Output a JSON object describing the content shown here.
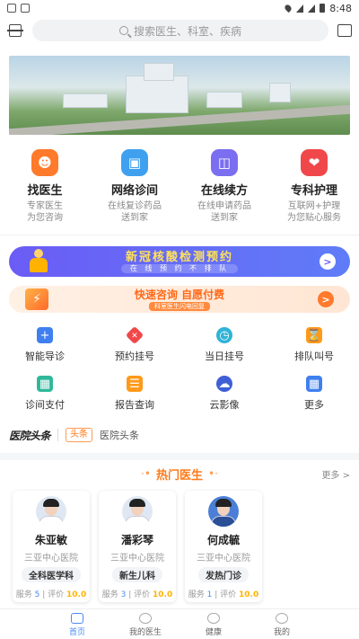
{
  "status_bar": {
    "time": "8:48"
  },
  "search": {
    "placeholder": "搜索医生、科室、疾病"
  },
  "main_services": [
    {
      "title": "找医生",
      "desc": "专家医生\n为您咨询",
      "color": "#ff7a2b",
      "icon": "doctor-icon"
    },
    {
      "title": "网络诊间",
      "desc": "在线复诊药品\n送到家",
      "color": "#3fa0f0",
      "icon": "monitor-icon"
    },
    {
      "title": "在线续方",
      "desc": "在线申请药品\n送到家",
      "color": "#7b6ef0",
      "icon": "capsule-icon"
    },
    {
      "title": "专科护理",
      "desc": "互联网+护理\n为您贴心服务",
      "color": "#f0484a",
      "icon": "heart-icon"
    }
  ],
  "promo1": {
    "title": "新冠核酸检测预约",
    "subtitle": "在 线 预 约  不 排 队"
  },
  "promo2": {
    "title": "快速咨询 自愿付费",
    "subtitle": "科室医生闪电回复"
  },
  "quick_grid": [
    {
      "label": "智能导诊",
      "color": "#3f7ff0",
      "icon": "briefcase-icon"
    },
    {
      "label": "预约挂号",
      "color": "#f0484a",
      "icon": "diamond-plus-icon"
    },
    {
      "label": "当日挂号",
      "color": "#2fb3d6",
      "icon": "clock-icon"
    },
    {
      "label": "排队叫号",
      "color": "#ff9a1a",
      "icon": "hourglass-icon"
    },
    {
      "label": "诊间支付",
      "color": "#2fb89a",
      "icon": "wallet-icon"
    },
    {
      "label": "报告查询",
      "color": "#ff9a1a",
      "icon": "report-icon"
    },
    {
      "label": "云影像",
      "color": "#3f5fd6",
      "icon": "cloud-icon"
    },
    {
      "label": "更多",
      "color": "#3f7ff0",
      "icon": "apps-icon"
    }
  ],
  "news": {
    "logo": "医院头条",
    "tag": "头条",
    "title": "医院头条"
  },
  "hot_doctors": {
    "title": "热门医生",
    "more": "更多 >",
    "service_label": "服务",
    "rating_label": "评价",
    "doctors": [
      {
        "name": "朱亚敏",
        "hospital": "三亚中心医院",
        "dept": "全科医学科",
        "services": "5",
        "score": "10.0"
      },
      {
        "name": "潘彩琴",
        "hospital": "三亚中心医院",
        "dept": "新生儿科",
        "services": "3",
        "score": "10.0"
      },
      {
        "name": "何成毓",
        "hospital": "三亚中心医院",
        "dept": "发热门诊",
        "services": "1",
        "score": "10.0"
      }
    ]
  },
  "tabbar": [
    {
      "label": "首页",
      "active": true
    },
    {
      "label": "我的医生",
      "active": false
    },
    {
      "label": "健康",
      "active": false
    },
    {
      "label": "我的",
      "active": false
    }
  ]
}
